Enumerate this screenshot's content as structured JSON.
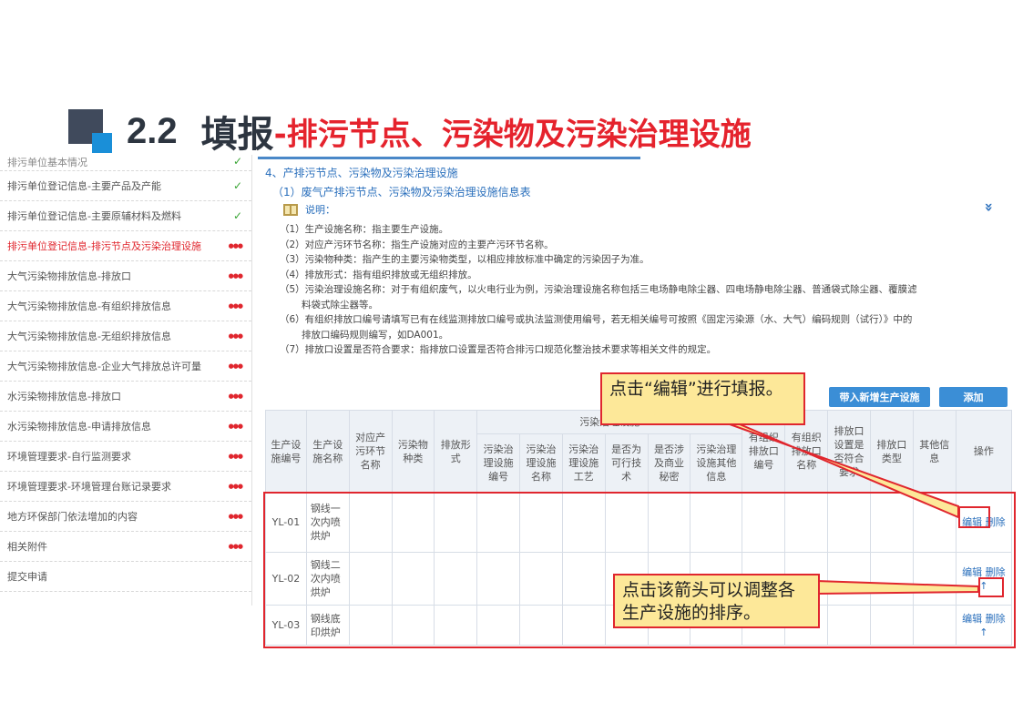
{
  "slide": {
    "number": "2.2",
    "title_main": "填报",
    "title_sub": "-排污节点、污染物及污染治理设施"
  },
  "sidebar": {
    "items": [
      {
        "label": "排污单位基本情况",
        "status": "check"
      },
      {
        "label": "排污单位登记信息-主要产品及产能",
        "status": "check"
      },
      {
        "label": "排污单位登记信息-主要原辅材料及燃料",
        "status": "check"
      },
      {
        "label": "排污单位登记信息-排污节点及污染治理设施",
        "status": "pending",
        "active": true
      },
      {
        "label": "大气污染物排放信息-排放口",
        "status": "pending"
      },
      {
        "label": "大气污染物排放信息-有组织排放信息",
        "status": "pending"
      },
      {
        "label": "大气污染物排放信息-无组织排放信息",
        "status": "pending"
      },
      {
        "label": "大气污染物排放信息-企业大气排放总许可量",
        "status": "pending"
      },
      {
        "label": "水污染物排放信息-排放口",
        "status": "pending"
      },
      {
        "label": "水污染物排放信息-申请排放信息",
        "status": "pending"
      },
      {
        "label": "环境管理要求-自行监测要求",
        "status": "pending"
      },
      {
        "label": "环境管理要求-环境管理台账记录要求",
        "status": "pending"
      },
      {
        "label": "地方环保部门依法增加的内容",
        "status": "pending"
      },
      {
        "label": "相关附件",
        "status": "pending"
      },
      {
        "label": "提交申请",
        "status": "none"
      }
    ],
    "check_glyph": "✓",
    "pending_glyph": "●●●"
  },
  "content": {
    "section_title": "4、产排污节点、污染物及污染治理设施",
    "subsection_title": "（1）废气产排污节点、污染物及污染治理设施信息表",
    "desc_label": "说明：",
    "collapse_icon": "»",
    "notes": [
      "（1）生产设施名称：指主要生产设施。",
      "（2）对应产污环节名称：指生产设施对应的主要产污环节名称。",
      "（3）污染物种类：指产生的主要污染物类型，以相应排放标准中确定的污染因子为准。",
      "（4）排放形式：指有组织排放或无组织排放。",
      "（5）污染治理设施名称：对于有组织废气，以火电行业为例，污染治理设施名称包括三电场静电除尘器、四电场静电除尘器、普通袋式除尘器、覆膜滤",
      "料袋式除尘器等。",
      "（6）有组织排放口编号请填写已有在线监测排放口编号或执法监测使用编号，若无相关编号可按照《固定污染源（水、大气）编码规则（试行）》中的",
      "排放口编码规则编写，如DA001。",
      "（7）排放口设置是否符合要求：指排放口设置是否符合排污口规范化整治技术要求等相关文件的规定。"
    ],
    "import_button": "带入新增生产设施",
    "add_button": "添加"
  },
  "table": {
    "group_header": "污染治理设施",
    "headers": {
      "facility_code": "生产设施编号",
      "facility_name": "生产设施名称",
      "process": "对应产污环节名称",
      "pollutant": "污染物种类",
      "emission_form": "排放形式",
      "treat_code": "污染治理设施编号",
      "treat_name": "污染治理设施名称",
      "treat_process": "污染治理设施工艺",
      "feasible": "是否为可行技术",
      "secret": "是否涉及商业秘密",
      "other_treat": "污染治理设施其他信息",
      "org_outlet_code": "有组织排放口编号",
      "org_outlet_name": "有组织排放口名称",
      "outlet_ok": "排放口设置是否符合要求",
      "outlet_type": "排放口类型",
      "other": "其他信息",
      "ops": "操作"
    },
    "rows": [
      {
        "code": "YL-01",
        "name": "钢线一次内喷烘炉",
        "edit": "编辑",
        "delete": "删除",
        "move": ""
      },
      {
        "code": "YL-02",
        "name": "钢线二次内喷烘炉",
        "edit": "编辑",
        "delete": "删除",
        "move": "↑"
      },
      {
        "code": "YL-03",
        "name": "钢线底印烘炉",
        "edit": "编辑",
        "delete": "删除",
        "move": "↑"
      }
    ]
  },
  "callouts": {
    "edit_hint": "点击“编辑”进行填报。",
    "sort_hint": "点击该箭头可以调整各生产设施的排序。"
  },
  "colors": {
    "accent_red": "#e0262e",
    "link_blue": "#2a6fbc",
    "button_blue": "#3b8ed6",
    "callout_fill": "#fde899",
    "check_green": "#3aa535"
  }
}
